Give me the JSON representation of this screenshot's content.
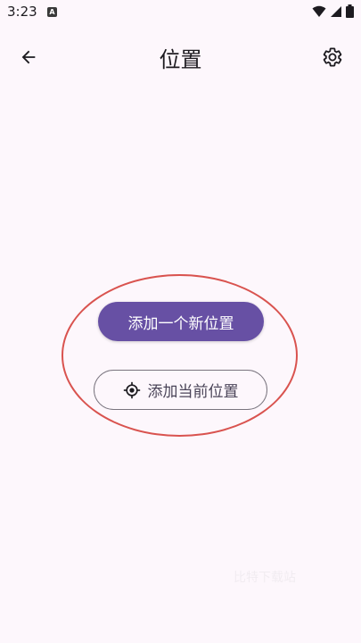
{
  "status_bar": {
    "time": "3:23",
    "notification_badge": "A",
    "icons": [
      "wifi-icon",
      "signal-icon",
      "battery-icon"
    ]
  },
  "top_bar": {
    "title": "位置",
    "back_icon": "arrow-back-icon",
    "settings_icon": "gear-icon"
  },
  "actions": {
    "add_new_label": "添加一个新位置",
    "add_current_label": "添加当前位置",
    "add_current_icon": "my-location-icon"
  },
  "watermark": "比特下载站",
  "colors": {
    "background": "#fdf7fc",
    "primary": "#6750a4",
    "highlight": "#d9534f"
  }
}
